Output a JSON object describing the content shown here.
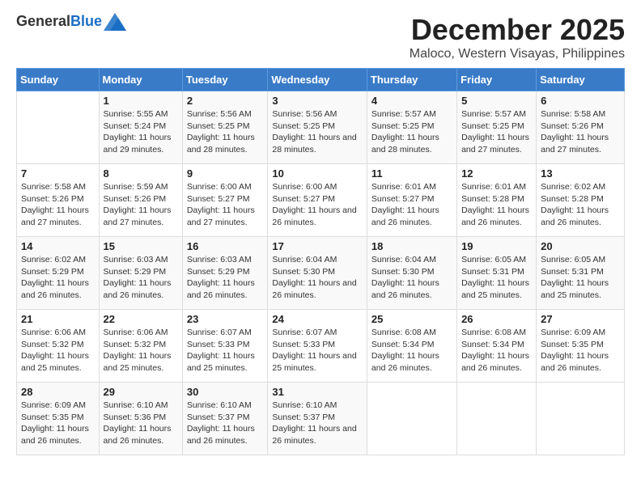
{
  "header": {
    "logo_line1": "General",
    "logo_line2": "Blue",
    "month": "December 2025",
    "location": "Maloco, Western Visayas, Philippines"
  },
  "weekdays": [
    "Sunday",
    "Monday",
    "Tuesday",
    "Wednesday",
    "Thursday",
    "Friday",
    "Saturday"
  ],
  "weeks": [
    [
      {
        "day": "",
        "info": ""
      },
      {
        "day": "1",
        "info": "Sunrise: 5:55 AM\nSunset: 5:24 PM\nDaylight: 11 hours and 29 minutes."
      },
      {
        "day": "2",
        "info": "Sunrise: 5:56 AM\nSunset: 5:25 PM\nDaylight: 11 hours and 28 minutes."
      },
      {
        "day": "3",
        "info": "Sunrise: 5:56 AM\nSunset: 5:25 PM\nDaylight: 11 hours and 28 minutes."
      },
      {
        "day": "4",
        "info": "Sunrise: 5:57 AM\nSunset: 5:25 PM\nDaylight: 11 hours and 28 minutes."
      },
      {
        "day": "5",
        "info": "Sunrise: 5:57 AM\nSunset: 5:25 PM\nDaylight: 11 hours and 27 minutes."
      },
      {
        "day": "6",
        "info": "Sunrise: 5:58 AM\nSunset: 5:26 PM\nDaylight: 11 hours and 27 minutes."
      }
    ],
    [
      {
        "day": "7",
        "info": "Sunrise: 5:58 AM\nSunset: 5:26 PM\nDaylight: 11 hours and 27 minutes."
      },
      {
        "day": "8",
        "info": "Sunrise: 5:59 AM\nSunset: 5:26 PM\nDaylight: 11 hours and 27 minutes."
      },
      {
        "day": "9",
        "info": "Sunrise: 6:00 AM\nSunset: 5:27 PM\nDaylight: 11 hours and 27 minutes."
      },
      {
        "day": "10",
        "info": "Sunrise: 6:00 AM\nSunset: 5:27 PM\nDaylight: 11 hours and 26 minutes."
      },
      {
        "day": "11",
        "info": "Sunrise: 6:01 AM\nSunset: 5:27 PM\nDaylight: 11 hours and 26 minutes."
      },
      {
        "day": "12",
        "info": "Sunrise: 6:01 AM\nSunset: 5:28 PM\nDaylight: 11 hours and 26 minutes."
      },
      {
        "day": "13",
        "info": "Sunrise: 6:02 AM\nSunset: 5:28 PM\nDaylight: 11 hours and 26 minutes."
      }
    ],
    [
      {
        "day": "14",
        "info": "Sunrise: 6:02 AM\nSunset: 5:29 PM\nDaylight: 11 hours and 26 minutes."
      },
      {
        "day": "15",
        "info": "Sunrise: 6:03 AM\nSunset: 5:29 PM\nDaylight: 11 hours and 26 minutes."
      },
      {
        "day": "16",
        "info": "Sunrise: 6:03 AM\nSunset: 5:29 PM\nDaylight: 11 hours and 26 minutes."
      },
      {
        "day": "17",
        "info": "Sunrise: 6:04 AM\nSunset: 5:30 PM\nDaylight: 11 hours and 26 minutes."
      },
      {
        "day": "18",
        "info": "Sunrise: 6:04 AM\nSunset: 5:30 PM\nDaylight: 11 hours and 26 minutes."
      },
      {
        "day": "19",
        "info": "Sunrise: 6:05 AM\nSunset: 5:31 PM\nDaylight: 11 hours and 25 minutes."
      },
      {
        "day": "20",
        "info": "Sunrise: 6:05 AM\nSunset: 5:31 PM\nDaylight: 11 hours and 25 minutes."
      }
    ],
    [
      {
        "day": "21",
        "info": "Sunrise: 6:06 AM\nSunset: 5:32 PM\nDaylight: 11 hours and 25 minutes."
      },
      {
        "day": "22",
        "info": "Sunrise: 6:06 AM\nSunset: 5:32 PM\nDaylight: 11 hours and 25 minutes."
      },
      {
        "day": "23",
        "info": "Sunrise: 6:07 AM\nSunset: 5:33 PM\nDaylight: 11 hours and 25 minutes."
      },
      {
        "day": "24",
        "info": "Sunrise: 6:07 AM\nSunset: 5:33 PM\nDaylight: 11 hours and 25 minutes."
      },
      {
        "day": "25",
        "info": "Sunrise: 6:08 AM\nSunset: 5:34 PM\nDaylight: 11 hours and 26 minutes."
      },
      {
        "day": "26",
        "info": "Sunrise: 6:08 AM\nSunset: 5:34 PM\nDaylight: 11 hours and 26 minutes."
      },
      {
        "day": "27",
        "info": "Sunrise: 6:09 AM\nSunset: 5:35 PM\nDaylight: 11 hours and 26 minutes."
      }
    ],
    [
      {
        "day": "28",
        "info": "Sunrise: 6:09 AM\nSunset: 5:35 PM\nDaylight: 11 hours and 26 minutes."
      },
      {
        "day": "29",
        "info": "Sunrise: 6:10 AM\nSunset: 5:36 PM\nDaylight: 11 hours and 26 minutes."
      },
      {
        "day": "30",
        "info": "Sunrise: 6:10 AM\nSunset: 5:37 PM\nDaylight: 11 hours and 26 minutes."
      },
      {
        "day": "31",
        "info": "Sunrise: 6:10 AM\nSunset: 5:37 PM\nDaylight: 11 hours and 26 minutes."
      },
      {
        "day": "",
        "info": ""
      },
      {
        "day": "",
        "info": ""
      },
      {
        "day": "",
        "info": ""
      }
    ]
  ]
}
